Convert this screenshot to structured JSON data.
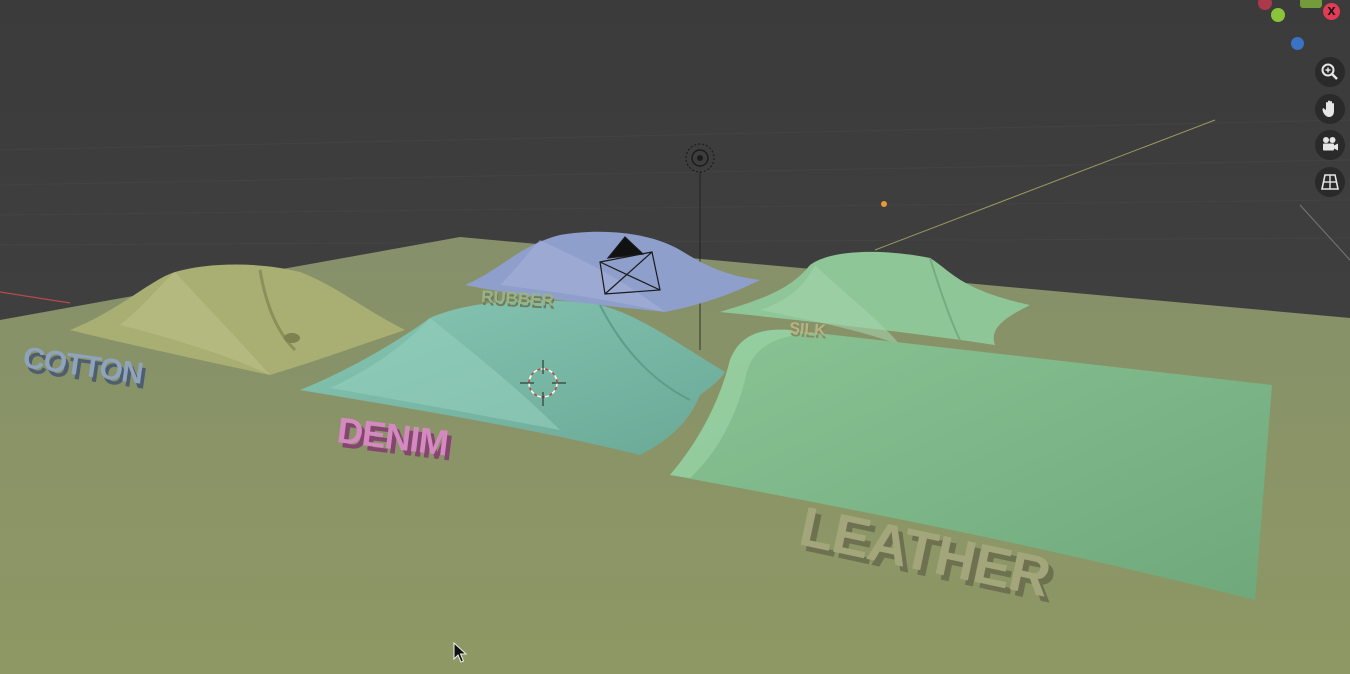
{
  "app": "Blender 3D Viewport",
  "labels": {
    "cotton": "COTTON",
    "denim": "DENIM",
    "rubber": "RUBBER",
    "silk": "SILK",
    "leather": "LEATHER"
  },
  "gizmo": {
    "x_axis_label": "X"
  },
  "nav_buttons": [
    {
      "name": "zoom-icon"
    },
    {
      "name": "hand-pan-icon"
    },
    {
      "name": "camera-view-icon"
    },
    {
      "name": "ortho-grid-icon"
    }
  ],
  "colors": {
    "background": "#3d3d3d",
    "floor": "#8c9667",
    "cotton_cloth": "#a7ad74",
    "rubber_cloth": "#8ea0cc",
    "silk_cloth": "#8cc596",
    "denim_cloth": "#79baa7",
    "leather_cloth": "#7db488",
    "x_axis": "#e23b55",
    "y_axis": "#8bc43b",
    "z_axis": "#3a72c4"
  }
}
